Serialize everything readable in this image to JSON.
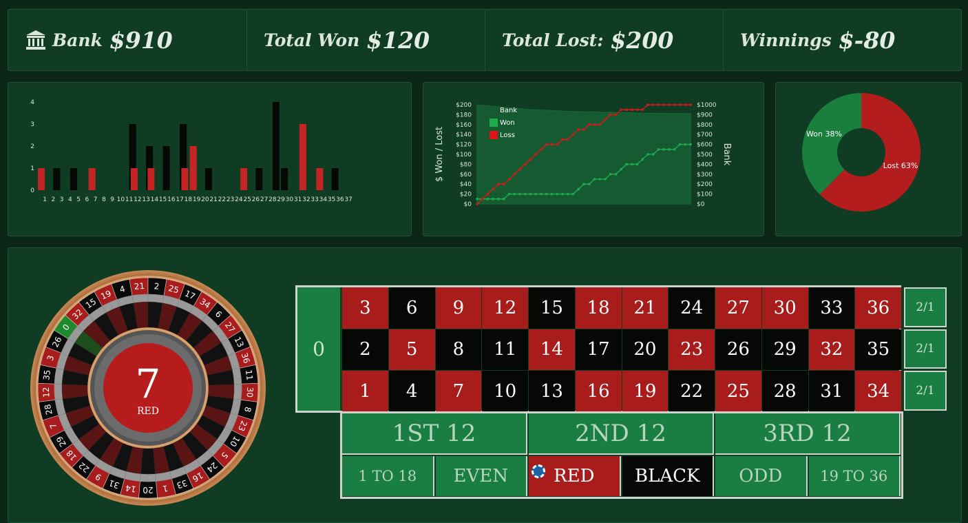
{
  "stats": [
    {
      "label": "Bank",
      "value": "$910",
      "icon": "bank-icon"
    },
    {
      "label": "Total Won",
      "value": "$120"
    },
    {
      "label": "Total Lost:",
      "value": "$200"
    },
    {
      "label": "Winnings",
      "value": "$-80"
    }
  ],
  "colors": {
    "red": "#a81c1c",
    "black": "#050805",
    "green": "#1a7e42",
    "panel": "#103c23",
    "won_line": "#1faa4f",
    "loss_line": "#d01a1a"
  },
  "chart_data": [
    {
      "type": "bar",
      "categories": [
        "1",
        "2",
        "3",
        "4",
        "5",
        "6",
        "7",
        "8",
        "9",
        "10",
        "11",
        "12",
        "13",
        "14",
        "15",
        "16",
        "17",
        "18",
        "19",
        "20",
        "21",
        "22",
        "23",
        "24",
        "25",
        "26",
        "27",
        "28",
        "29",
        "30",
        "31",
        "32",
        "33",
        "34",
        "35",
        "36",
        "37"
      ],
      "series": [
        {
          "color": "#c42424",
          "values": [
            1,
            0,
            0,
            0,
            0,
            0,
            1,
            0,
            0,
            0,
            0,
            1,
            0,
            1,
            0,
            0,
            0,
            1,
            2,
            0,
            0,
            0,
            0,
            0,
            1,
            0,
            0,
            0,
            0,
            0,
            0,
            3,
            0,
            1,
            0,
            0,
            0
          ]
        },
        {
          "color": "#050805",
          "values": [
            0,
            1,
            0,
            1,
            0,
            0,
            0,
            0,
            0,
            0,
            3,
            0,
            2,
            0,
            2,
            0,
            3,
            0,
            0,
            1,
            0,
            0,
            0,
            0,
            0,
            1,
            0,
            4,
            1,
            0,
            0,
            0,
            0,
            0,
            1,
            0,
            0
          ]
        }
      ],
      "yticks": [
        "0",
        "1",
        "2",
        "3",
        "4"
      ],
      "ylim": [
        0,
        4
      ]
    },
    {
      "type": "line",
      "ylabel": "$ Won / Lost",
      "y2label": "Bank",
      "yticks": [
        "$0",
        "$20",
        "$40",
        "$60",
        "$80",
        "$100",
        "$120",
        "$140",
        "$160",
        "$180",
        "$200"
      ],
      "y2ticks": [
        "$0",
        "$100",
        "$200",
        "$300",
        "$400",
        "$500",
        "$600",
        "$700",
        "$800",
        "$900",
        "$1000"
      ],
      "ylim": [
        0,
        200
      ],
      "y2lim": [
        0,
        1000
      ],
      "legend": [
        {
          "name": "Bank",
          "color": "#165a31"
        },
        {
          "name": "Won",
          "color": "#1faa4f"
        },
        {
          "name": "Loss",
          "color": "#e01414"
        }
      ],
      "series": [
        {
          "name": "Bank",
          "axis": "right",
          "values": [
            1000,
            995,
            990,
            985,
            980,
            975,
            970,
            965,
            960,
            955,
            950,
            950,
            945,
            945,
            940,
            940,
            935,
            935,
            930,
            930,
            928,
            925,
            930,
            925,
            920,
            925,
            920,
            922,
            920,
            918,
            916,
            915,
            914,
            915,
            913,
            912,
            911,
            912,
            911,
            910,
            910
          ]
        },
        {
          "name": "Won",
          "values": [
            10,
            10,
            10,
            10,
            10,
            10,
            20,
            20,
            20,
            20,
            20,
            20,
            20,
            20,
            20,
            20,
            20,
            20,
            20,
            30,
            40,
            40,
            50,
            50,
            50,
            60,
            60,
            70,
            80,
            80,
            80,
            90,
            100,
            100,
            110,
            110,
            110,
            110,
            120,
            120,
            120
          ]
        },
        {
          "name": "Loss",
          "values": [
            0,
            10,
            20,
            30,
            40,
            40,
            50,
            60,
            70,
            80,
            90,
            100,
            110,
            120,
            120,
            120,
            130,
            130,
            140,
            150,
            150,
            160,
            160,
            160,
            170,
            180,
            180,
            190,
            190,
            190,
            190,
            190,
            200,
            200,
            200,
            200,
            200,
            200,
            200,
            200,
            200
          ]
        }
      ]
    },
    {
      "type": "pie",
      "slices": [
        {
          "label": "Won 38%",
          "value": 38,
          "color": "#1a7e3c"
        },
        {
          "label": "Lost 63%",
          "value": 63,
          "color": "#b31d1d"
        }
      ]
    }
  ],
  "wheel": {
    "result_number": "7",
    "result_color": "RED",
    "sequence": [
      "0",
      "32",
      "15",
      "19",
      "4",
      "21",
      "2",
      "25",
      "17",
      "34",
      "6",
      "27",
      "13",
      "36",
      "11",
      "30",
      "8",
      "23",
      "10",
      "5",
      "24",
      "16",
      "33",
      "1",
      "20",
      "14",
      "31",
      "9",
      "22",
      "18",
      "29",
      "7",
      "28",
      "12",
      "35",
      "3",
      "26"
    ]
  },
  "table": {
    "zero": "0",
    "rows": [
      [
        {
          "n": "3",
          "c": "red"
        },
        {
          "n": "6",
          "c": "black"
        },
        {
          "n": "9",
          "c": "red"
        },
        {
          "n": "12",
          "c": "red"
        },
        {
          "n": "15",
          "c": "black"
        },
        {
          "n": "18",
          "c": "red"
        },
        {
          "n": "21",
          "c": "red"
        },
        {
          "n": "24",
          "c": "black"
        },
        {
          "n": "27",
          "c": "red"
        },
        {
          "n": "30",
          "c": "red"
        },
        {
          "n": "33",
          "c": "black"
        },
        {
          "n": "36",
          "c": "red"
        }
      ],
      [
        {
          "n": "2",
          "c": "black"
        },
        {
          "n": "5",
          "c": "red"
        },
        {
          "n": "8",
          "c": "black"
        },
        {
          "n": "11",
          "c": "black"
        },
        {
          "n": "14",
          "c": "red"
        },
        {
          "n": "17",
          "c": "black"
        },
        {
          "n": "20",
          "c": "black"
        },
        {
          "n": "23",
          "c": "red"
        },
        {
          "n": "26",
          "c": "black"
        },
        {
          "n": "29",
          "c": "black"
        },
        {
          "n": "32",
          "c": "red"
        },
        {
          "n": "35",
          "c": "black"
        }
      ],
      [
        {
          "n": "1",
          "c": "red"
        },
        {
          "n": "4",
          "c": "black"
        },
        {
          "n": "7",
          "c": "red"
        },
        {
          "n": "10",
          "c": "black"
        },
        {
          "n": "13",
          "c": "black"
        },
        {
          "n": "16",
          "c": "red"
        },
        {
          "n": "19",
          "c": "red"
        },
        {
          "n": "22",
          "c": "black"
        },
        {
          "n": "25",
          "c": "red"
        },
        {
          "n": "28",
          "c": "black"
        },
        {
          "n": "31",
          "c": "black"
        },
        {
          "n": "34",
          "c": "red"
        }
      ]
    ],
    "columns": [
      "2/1",
      "2/1",
      "2/1"
    ],
    "dozens": [
      "1ST 12",
      "2ND 12",
      "3RD 12"
    ],
    "outside": [
      {
        "label": "1 TO 18",
        "c": "green"
      },
      {
        "label": "EVEN",
        "c": "green"
      },
      {
        "label": "RED",
        "c": "red",
        "chip": true
      },
      {
        "label": "BLACK",
        "c": "black"
      },
      {
        "label": "ODD",
        "c": "green"
      },
      {
        "label": "19 TO 36",
        "c": "green"
      }
    ]
  }
}
